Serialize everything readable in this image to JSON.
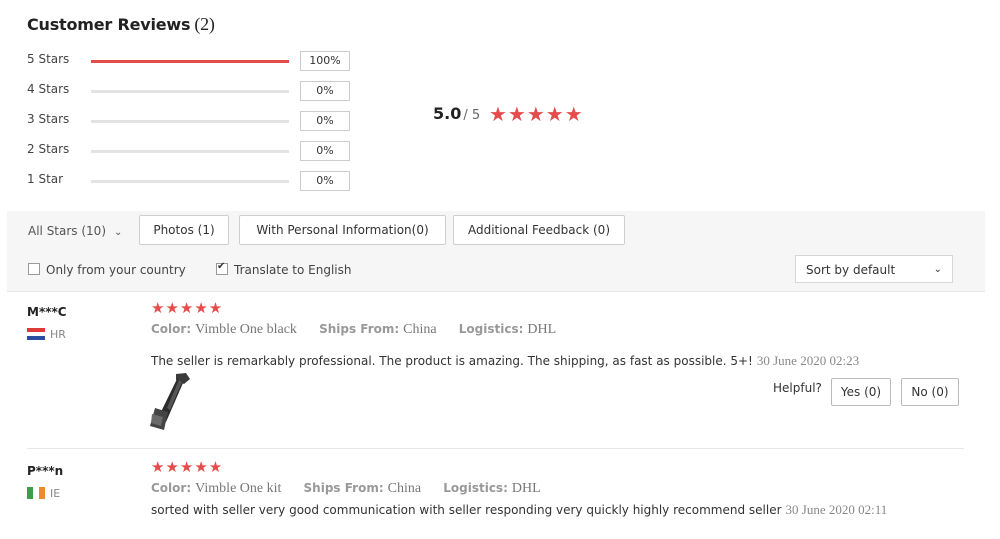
{
  "header": {
    "title": "Customer Reviews",
    "count": "(2)"
  },
  "distribution": [
    {
      "label": "5 Stars",
      "percent": "100%",
      "fill": 1.0
    },
    {
      "label": "4 Stars",
      "percent": "0%",
      "fill": 0.0
    },
    {
      "label": "3 Stars",
      "percent": "0%",
      "fill": 0.0
    },
    {
      "label": "2 Stars",
      "percent": "0%",
      "fill": 0.0
    },
    {
      "label": "1 Star",
      "percent": "0%",
      "fill": 0.0
    }
  ],
  "overall": {
    "score": "5.0",
    "max": "/ 5",
    "stars": "★★★★★",
    "star_color": "#e74c4c"
  },
  "filters": {
    "star_filter": "All Stars (10)",
    "photos": "Photos (1)",
    "personal": "With Personal Information(0)",
    "additional": "Additional Feedback (0)",
    "only_country": "Only from your country",
    "only_country_checked": false,
    "translate": "Translate to English",
    "translate_checked": true,
    "sort": "Sort by default"
  },
  "reviews": [
    {
      "user": "M***C",
      "country": "HR",
      "stars": "★★★★★",
      "color_label": "Color:",
      "color": "Vimble One black",
      "ships_label": "Ships From:",
      "ships": "China",
      "logistics_label": "Logistics:",
      "logistics": "DHL",
      "text": "The seller is remarkably professional. The product is amazing. The shipping, as fast as possible. 5+!",
      "date": "30 June 2020 02:23",
      "helpful": "Helpful?",
      "yes": "Yes (0)",
      "no": "No (0)"
    },
    {
      "user": "P***n",
      "country": "IE",
      "stars": "★★★★★",
      "color_label": "Color:",
      "color": "Vimble One kit",
      "ships_label": "Ships From:",
      "ships": "China",
      "logistics_label": "Logistics:",
      "logistics": "DHL",
      "text": "sorted with seller very good communication with seller responding very quickly highly recommend seller",
      "date": "30 June  2020 02:11"
    }
  ],
  "colors": {
    "accent": "#e74c4c",
    "bar_track": "#e3e3e3",
    "filter_bg": "#f6f6f6"
  }
}
